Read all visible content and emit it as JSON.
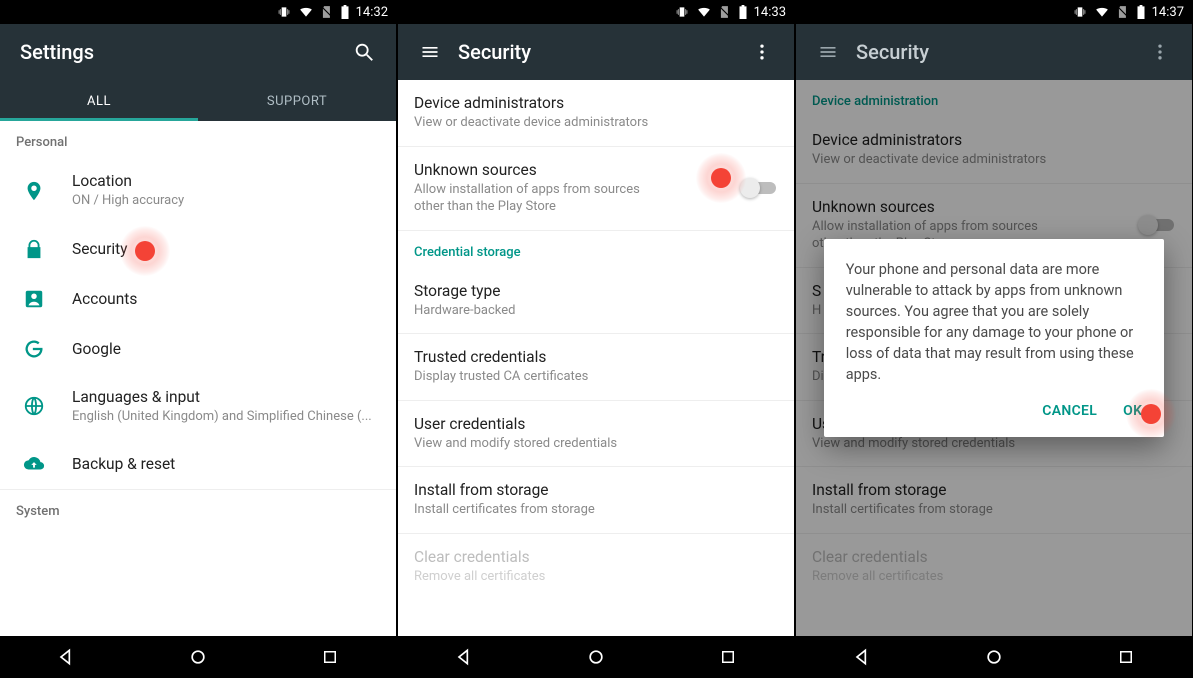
{
  "status": {
    "times": [
      "14:32",
      "14:33",
      "14:37"
    ]
  },
  "screen1": {
    "title": "Settings",
    "tabs": {
      "all": "ALL",
      "support": "SUPPORT"
    },
    "sections": {
      "personal": "Personal",
      "system": "System"
    },
    "items": {
      "location": {
        "title": "Location",
        "sub": "ON / High accuracy"
      },
      "security": {
        "title": "Security"
      },
      "accounts": {
        "title": "Accounts"
      },
      "google": {
        "title": "Google"
      },
      "lang": {
        "title": "Languages & input",
        "sub": "English (United Kingdom) and Simplified Chinese (..."
      },
      "backup": {
        "title": "Backup & reset"
      }
    }
  },
  "screen2": {
    "title": "Security",
    "items": {
      "devadmin": {
        "title": "Device administrators",
        "sub": "View or deactivate device administrators"
      },
      "unknown": {
        "title": "Unknown sources",
        "sub": "Allow installation of apps from sources other than the Play Store"
      },
      "credhdr": "Credential storage",
      "storage": {
        "title": "Storage type",
        "sub": "Hardware-backed"
      },
      "trusted": {
        "title": "Trusted credentials",
        "sub": "Display trusted CA certificates"
      },
      "usercred": {
        "title": "User credentials",
        "sub": "View and modify stored credentials"
      },
      "install": {
        "title": "Install from storage",
        "sub": "Install certificates from storage"
      },
      "clear": {
        "title": "Clear credentials",
        "sub": "Remove all certificates"
      }
    }
  },
  "screen3": {
    "title": "Security",
    "section": "Device administration",
    "items": {
      "devadmin": {
        "title": "Device administrators",
        "sub": "View or deactivate device administrators"
      },
      "unknown": {
        "title": "Unknown sources",
        "sub": "Allow installation of apps from sources other than the Play Store"
      },
      "storage_initial": "S",
      "storage_sub_initial": "H",
      "trusted": {
        "title": "Trusted credentials",
        "sub": "Display trusted CA certificates"
      },
      "usercred": {
        "title": "User credentials",
        "sub": "View and modify stored credentials"
      },
      "install": {
        "title": "Install from storage",
        "sub": "Install certificates from storage"
      },
      "clear": {
        "title": "Clear credentials",
        "sub": "Remove all certificates"
      }
    },
    "dialog": {
      "body": "Your phone and personal data are more vulnerable to attack by apps from unknown sources. You agree that you are solely responsible for any damage to your phone or loss of data that may result from using these apps.",
      "cancel": "CANCEL",
      "ok": "OK"
    }
  }
}
